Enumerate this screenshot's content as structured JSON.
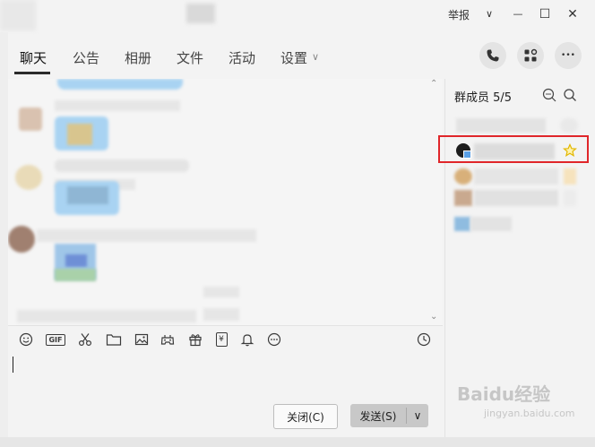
{
  "titlebar": {
    "report_label": "举报",
    "dropdown_glyph": "∨",
    "minimize_glyph": "—",
    "maximize_glyph": "☐",
    "close_glyph": "✕"
  },
  "tabs": [
    {
      "label": "聊天",
      "active": true
    },
    {
      "label": "公告",
      "active": false
    },
    {
      "label": "相册",
      "active": false
    },
    {
      "label": "文件",
      "active": false
    },
    {
      "label": "活动",
      "active": false
    },
    {
      "label": "设置",
      "active": false
    }
  ],
  "settings_chevron": "∨",
  "header_actions": [
    "phone-icon",
    "apps-icon",
    "more-icon"
  ],
  "more_glyph": "•••",
  "toolbar_icons": [
    "emoji-icon",
    "gif-icon",
    "scissors-icon",
    "folder-icon",
    "image-icon",
    "gamepad-icon",
    "gift-icon",
    "red-packet-icon",
    "bell-icon",
    "more-dots-icon",
    "history-icon"
  ],
  "gif_text": "GIF",
  "red_packet_text": "¥",
  "buttons": {
    "close_label": "关闭(C)",
    "send_label": "发送(S)",
    "send_menu_glyph": "∨"
  },
  "members": {
    "title": "群成员 5/5"
  },
  "watermark": {
    "main": "Baidu经验",
    "sub": "jingyan.baidu.com"
  },
  "colors": {
    "highlight": "#e0262a",
    "bubble_blue": "#a9d3f2"
  }
}
